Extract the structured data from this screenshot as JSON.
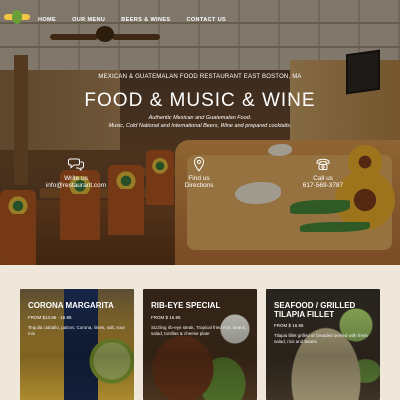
{
  "nav": {
    "items": [
      "HOME",
      "OUR MENU",
      "BEERS & WINES",
      "CONTACT US"
    ]
  },
  "hero": {
    "tagline": "MEXICAN & GUATEMALAN FOOD RESTAURANT EAST BOSTON, MA",
    "headline": "FOOD & MUSIC & WINE",
    "subline1": "Authentic Mexican and Guatemalan Food.",
    "subline2": "Music, Cold National and International Beers, Wine and prepared cocktails."
  },
  "info": [
    {
      "icon": "chat-bubbles-icon",
      "line1": "Write us",
      "line2": "info@restaurant.com"
    },
    {
      "icon": "location-pin-icon",
      "line1": "Find us",
      "line2": "Directions"
    },
    {
      "icon": "phone-icon",
      "line1": "Call us",
      "line2": "617-569-3787"
    }
  ],
  "cards": [
    {
      "title": "CORONA MARGARITA",
      "price": "FROM $13.95 - 16.95",
      "desc": "Tequila ciaballo, patron, Corona, limes, salt, sour mix"
    },
    {
      "title": "RIB-EYE SPECIAL",
      "price": "FROM $ 16.95",
      "desc": "Sizzling rib-eye steak, Tropical fried rice, beans, salad, tortillas & cheese plate"
    },
    {
      "title": "SEAFOOD / GRILLED TILAPIA FILLET",
      "price": "FROM $ 16.95",
      "desc": "Tilapia fillet grilled or breaded served with fresh salad, rice and beans"
    }
  ],
  "colors": {
    "accent": "#f3c442",
    "booth": "#d89a4e",
    "background": "#f4efe6"
  }
}
